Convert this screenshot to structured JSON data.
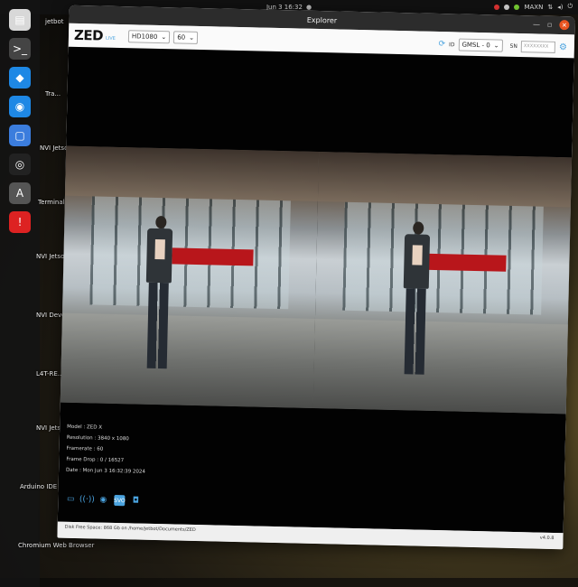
{
  "topbar": {
    "clock": "Jun 3 16:32",
    "tray_text": "MAXN"
  },
  "dock": {
    "items": [
      {
        "name": "files-icon",
        "glyph": "▤",
        "color": "#d8d8d8"
      },
      {
        "name": "terminal-icon",
        "glyph": ">_",
        "color": "#444"
      },
      {
        "name": "vscode-icon",
        "glyph": "◆",
        "color": "#1e88e5"
      },
      {
        "name": "chromium-icon",
        "glyph": "◉",
        "color": "#1e88e5"
      },
      {
        "name": "screenshot-icon",
        "glyph": "▢",
        "color": "#3b7ddd"
      },
      {
        "name": "obs-icon",
        "glyph": "◎",
        "color": "#222"
      },
      {
        "name": "software-icon",
        "glyph": "A",
        "color": "#555"
      },
      {
        "name": "error-icon",
        "glyph": "!",
        "color": "#d22"
      }
    ]
  },
  "desktop": {
    "labels": [
      "jetbot",
      "Tra...",
      "NVI Jetso...",
      "Terminal",
      "NVI Jetson Pro",
      "NVI Develop...",
      "L4T-RE...",
      "NVI Jetson Commun...",
      "Arduino IDE",
      "Chromium Web Browser"
    ]
  },
  "window": {
    "title": "Explorer",
    "logo": "ZED",
    "live_badge": "LIVE",
    "resolution_select": "HD1080",
    "fps_select": "60",
    "id_label": "ID",
    "interface_select": "GMSL - 0",
    "sn_label": "SN",
    "sn_placeholder": "XXXXXXXX"
  },
  "camera_info": {
    "model": "Model : ZED X",
    "resolution": "Resolution : 3840 x 1080",
    "framerate": "Framerate : 60",
    "frame_drop": "Frame Drop : 0 / 16527",
    "date": "Date : Mon Jun 3 16:32:39 2024"
  },
  "footer": {
    "disk_space": "Disk Free Space: 868 Gb  on /home/jetbot/Documents/ZED",
    "version": "v4.0.8"
  },
  "colors": {
    "accent": "#4aa3df",
    "close": "#e95420"
  }
}
